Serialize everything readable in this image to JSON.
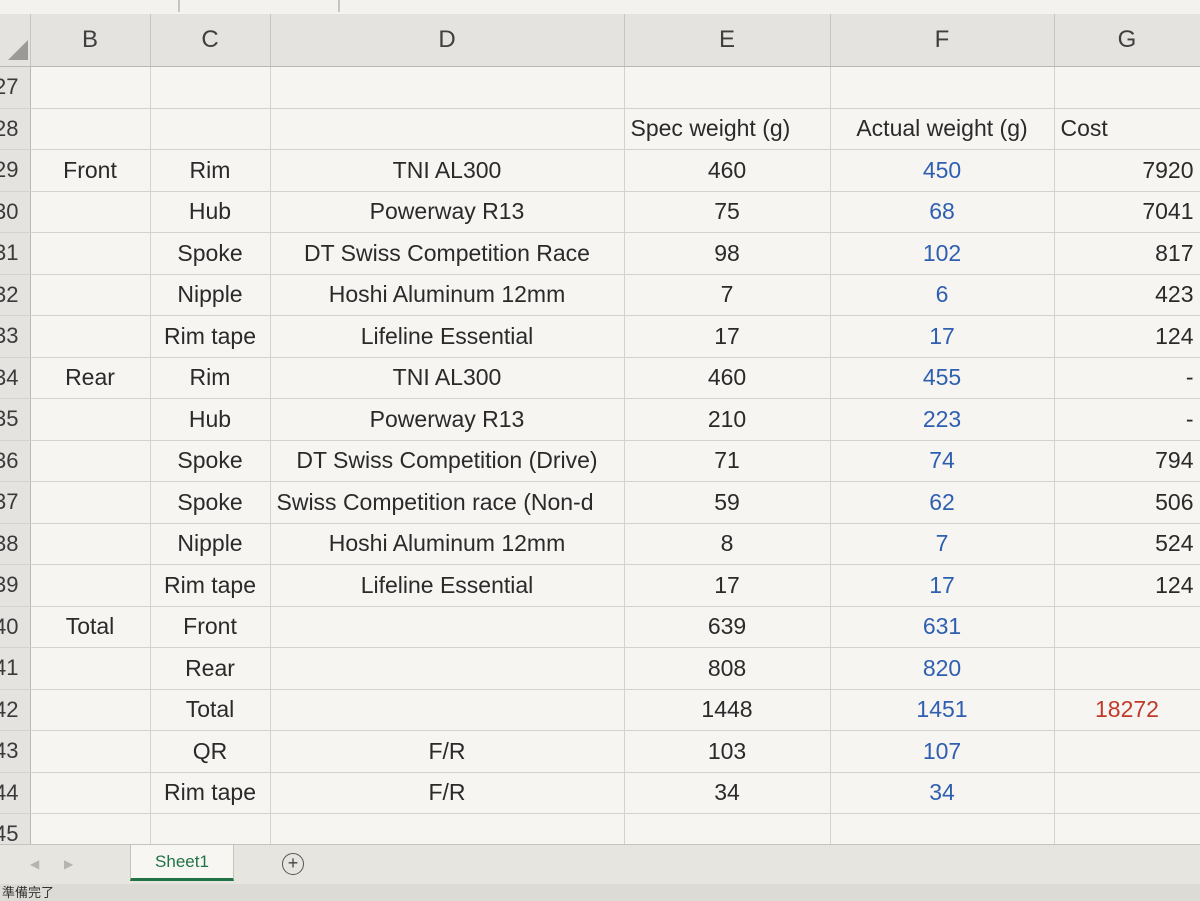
{
  "columns": [
    "B",
    "C",
    "D",
    "E",
    "F",
    "G"
  ],
  "rows": [
    {
      "num": "27",
      "b": "",
      "c": "",
      "d": "",
      "e": "",
      "f": "",
      "g": ""
    },
    {
      "num": "28",
      "b": "",
      "c": "",
      "d": "",
      "e": "Spec weight (g)",
      "f": "Actual weight (g)",
      "g": "Cost"
    },
    {
      "num": "29",
      "b": "Front",
      "c": "Rim",
      "d": "TNI AL300",
      "e": "460",
      "f": "450",
      "g": "7920"
    },
    {
      "num": "30",
      "b": "",
      "c": "Hub",
      "d": "Powerway R13",
      "e": "75",
      "f": "68",
      "g": "7041"
    },
    {
      "num": "31",
      "b": "",
      "c": "Spoke",
      "d": "DT Swiss Competition Race",
      "e": "98",
      "f": "102",
      "g": "817"
    },
    {
      "num": "32",
      "b": "",
      "c": "Nipple",
      "d": "Hoshi Aluminum 12mm",
      "e": "7",
      "f": "6",
      "g": "423"
    },
    {
      "num": "33",
      "b": "",
      "c": "Rim tape",
      "d": "Lifeline Essential",
      "e": "17",
      "f": "17",
      "g": "124"
    },
    {
      "num": "34",
      "b": "Rear",
      "c": "Rim",
      "d": "TNI AL300",
      "e": "460",
      "f": "455",
      "g": "-"
    },
    {
      "num": "35",
      "b": "",
      "c": "Hub",
      "d": "Powerway R13",
      "e": "210",
      "f": "223",
      "g": "-"
    },
    {
      "num": "36",
      "b": "",
      "c": "Spoke",
      "d": "DT Swiss Competition (Drive)",
      "e": "71",
      "f": "74",
      "g": "794"
    },
    {
      "num": "37",
      "b": "",
      "c": "Spoke",
      "d": "Swiss Competition race (Non-d",
      "e": "59",
      "f": "62",
      "g": "506"
    },
    {
      "num": "38",
      "b": "",
      "c": "Nipple",
      "d": "Hoshi Aluminum 12mm",
      "e": "8",
      "f": "7",
      "g": "524"
    },
    {
      "num": "39",
      "b": "",
      "c": "Rim tape",
      "d": "Lifeline Essential",
      "e": "17",
      "f": "17",
      "g": "124"
    },
    {
      "num": "40",
      "b": "Total",
      "c": "Front",
      "d": "",
      "e": "639",
      "f": "631",
      "g": ""
    },
    {
      "num": "41",
      "b": "",
      "c": "Rear",
      "d": "",
      "e": "808",
      "f": "820",
      "g": ""
    },
    {
      "num": "42",
      "b": "",
      "c": "Total",
      "d": "",
      "e": "1448",
      "f": "1451",
      "g": "18272"
    },
    {
      "num": "43",
      "b": "",
      "c": "QR",
      "d": "F/R",
      "e": "103",
      "f": "107",
      "g": ""
    },
    {
      "num": "44",
      "b": "",
      "c": "Rim tape",
      "d": "F/R",
      "e": "34",
      "f": "34",
      "g": ""
    },
    {
      "num": "45",
      "b": "",
      "c": "",
      "d": "",
      "e": "",
      "f": "",
      "g": ""
    }
  ],
  "sheet_tab": "Sheet1",
  "add_sheet_symbol": "+",
  "status_text": "準備完了",
  "colors": {
    "actual_weight": "#2f5fb0",
    "total_cost": "#c03a2b",
    "sheet_tab_accent": "#217346"
  }
}
